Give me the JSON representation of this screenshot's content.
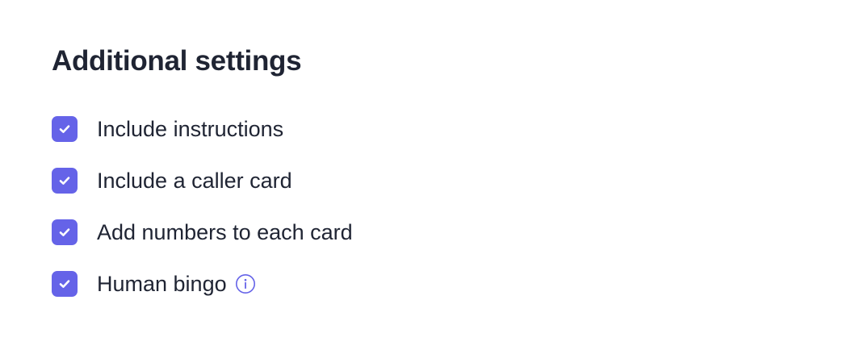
{
  "settings": {
    "title": "Additional settings",
    "accent_color": "#6563e8",
    "options": [
      {
        "label": "Include instructions",
        "checked": true
      },
      {
        "label": "Include a caller card",
        "checked": true
      },
      {
        "label": "Add numbers to each card",
        "checked": true
      },
      {
        "label": "Human bingo",
        "checked": true,
        "icon": "info-icon"
      }
    ]
  }
}
